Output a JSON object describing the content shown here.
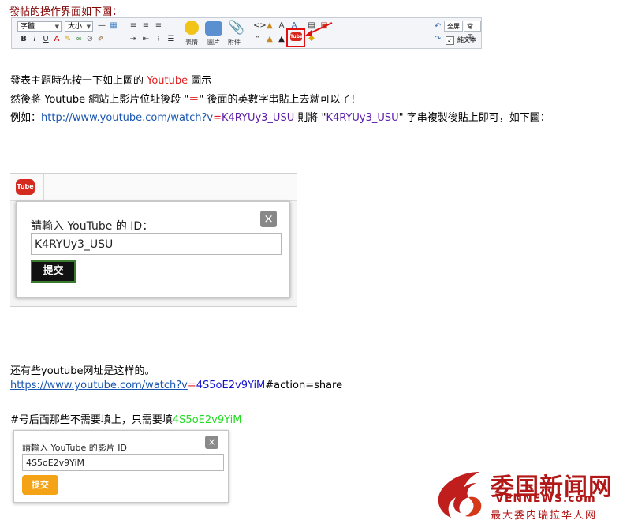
{
  "title": "發帖的操作界面如下圖：",
  "toolbar": {
    "font_select": "字體",
    "size_select": "大小",
    "fullscreen_label": "全屏",
    "common_label": "常用",
    "emoticon_label": "表情",
    "image_label": "圖片",
    "attach_label": "附件",
    "plaintext_label": "純文本",
    "youtube_icon_text": "Tube"
  },
  "para1": {
    "prefix": "發表主題時先按一下如上圖的 ",
    "highlight": "Youtube",
    "suffix": " 圖示"
  },
  "para2": {
    "text_before": "然後將 Youtube 網站上影片位址後段 \"",
    "symbol": "＝",
    "text_after": "\" 後面的英數字串貼上去就可以了！"
  },
  "para3": {
    "prefix": "例如：",
    "url": "http://www.youtube.com/watch?v",
    "eq": "=",
    "id": "K4RYUy3_USU",
    "middle1": " 則將 \"",
    "id2": "K4RYUy3_USU",
    "suffix": "\" 字串複製後貼上即可，如下圖："
  },
  "dialog1": {
    "youtube_tab_text": "Tube",
    "label": "請輸入 YouTube 的 ID：",
    "value": "K4RYUy3_USU",
    "close": "×",
    "submit": "提交"
  },
  "para4": "还有些youtube网址是这样的。",
  "para5": {
    "url": "https://www.youtube.com/watch?v",
    "eq": "=",
    "id": "4S5oE2v9YiM",
    "suffix": "#action=share"
  },
  "para6": {
    "prefix": "#号后面那些不需要填上，只需要填",
    "id": "4S5oE2v9YiM"
  },
  "dialog2": {
    "label": "請輸入 YouTube 的影片 ID",
    "value": "4S5oE2v9YiM",
    "close": "×",
    "submit": "提交"
  },
  "watermark": {
    "chinese": "委国新闻网",
    "english": "VENNEWS.com",
    "tagline": "最大委内瑞拉华人网"
  },
  "colors": {
    "title": "#800000",
    "highlight_red": "#e02020",
    "link": "#1a56b0",
    "id_purple": "#5c1ca8",
    "id_green": "#22dd22",
    "watermark": "#b31818",
    "submit_orange": "#f5a316"
  }
}
